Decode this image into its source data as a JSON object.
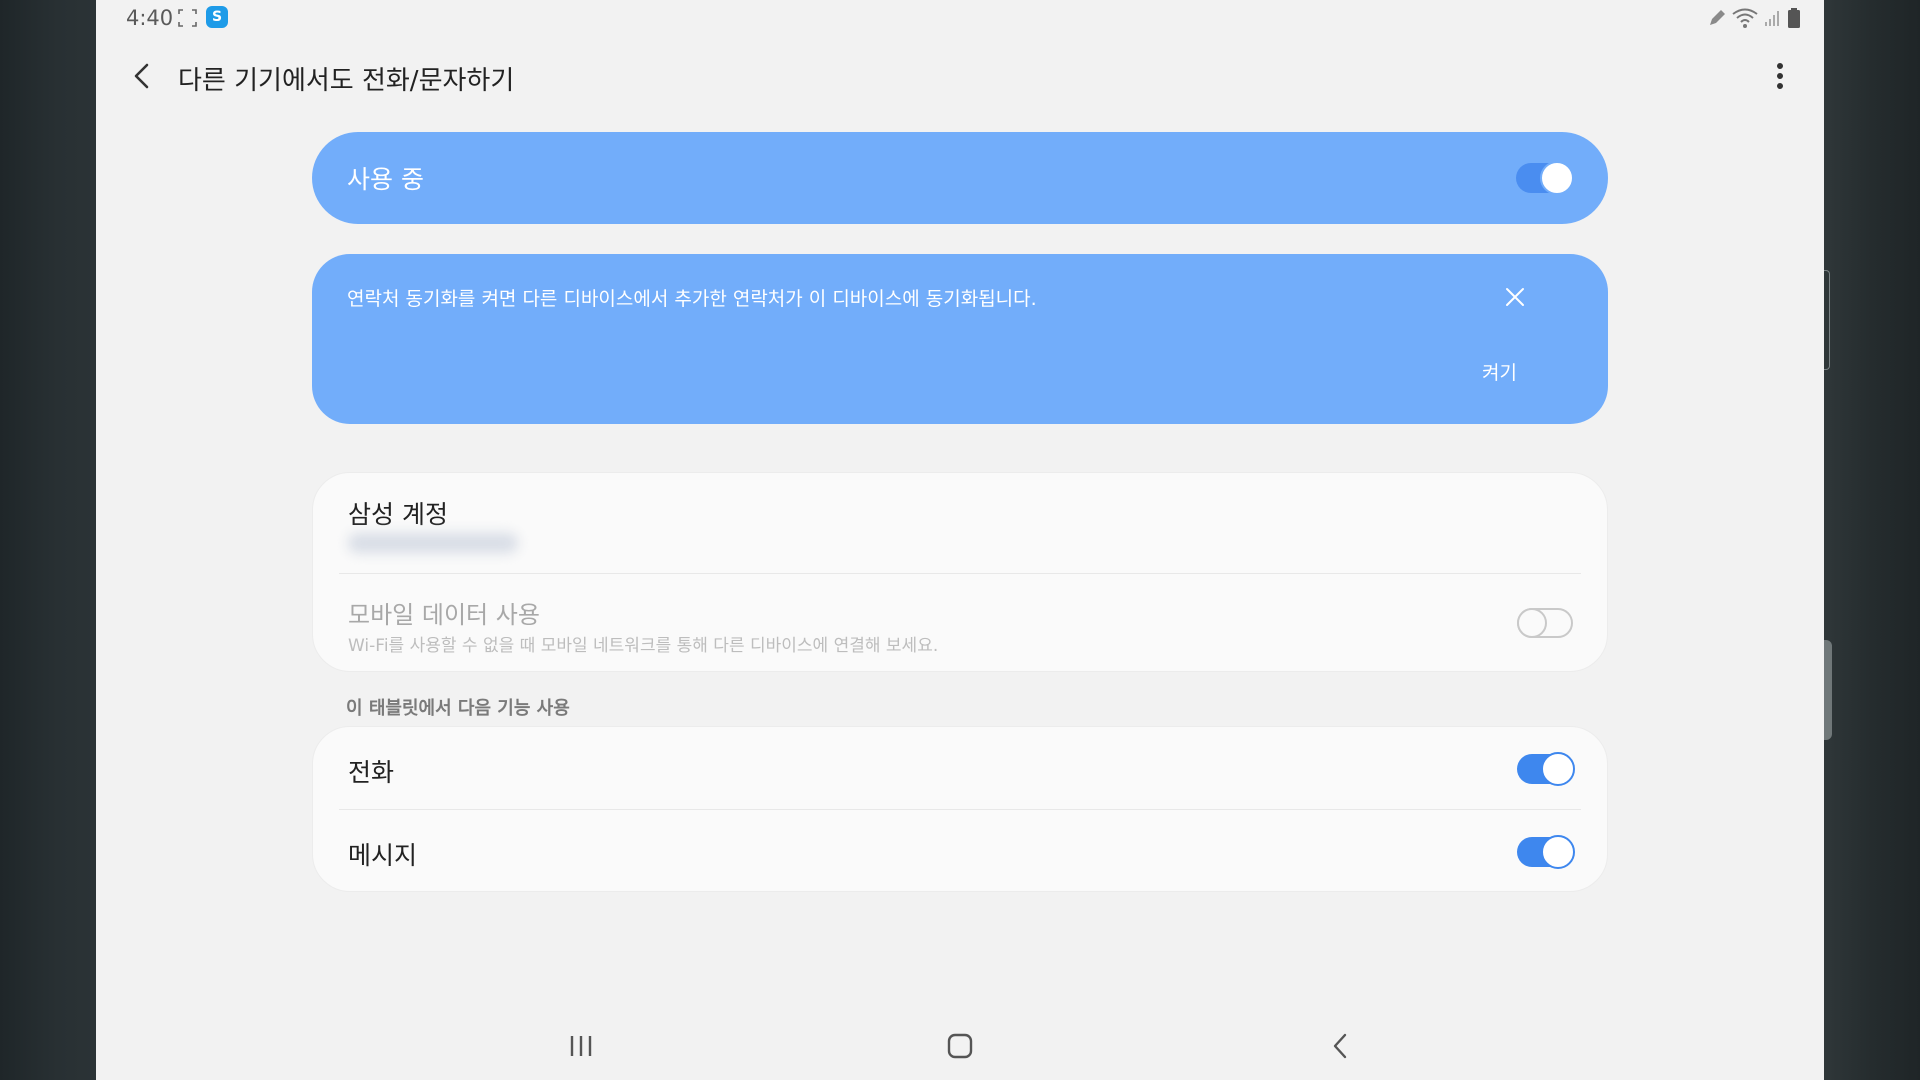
{
  "status_bar": {
    "time": "4:40",
    "app_icon_letter": "S",
    "icons": [
      "screenshot-icon",
      "s-app-icon",
      "pen-icon",
      "wifi-icon",
      "signal-icon",
      "battery-icon"
    ]
  },
  "app_bar": {
    "title": "다른 기기에서도 전화/문자하기",
    "back_icon": "back-arrow-icon",
    "more_icon": "more-vertical-icon"
  },
  "master_switch": {
    "label": "사용 중",
    "state": "on"
  },
  "notice": {
    "text": "연락처 동기화를 켜면 다른 디바이스에서 추가한 연락처가 이 디바이스에 동기화됩니다.",
    "action_label": "켜기",
    "close_icon": "close-icon"
  },
  "account": {
    "title": "삼성 계정"
  },
  "mobile_data": {
    "title": "모바일 데이터 사용",
    "subtitle": "Wi-Fi를 사용할 수 없을 때 모바일 네트워크를 통해 다른 디바이스에 연결해 보세요.",
    "state": "off"
  },
  "features": {
    "header": "이 태블릿에서 다음 기능 사용",
    "items": [
      {
        "label": "전화",
        "state": "on"
      },
      {
        "label": "메시지",
        "state": "on"
      }
    ]
  },
  "nav_bar": {
    "buttons": [
      "recents-icon",
      "home-icon",
      "back-icon"
    ]
  },
  "colors": {
    "accent": "#3e87ee",
    "card_blue": "#72adfa",
    "background": "#f2f2f2"
  }
}
